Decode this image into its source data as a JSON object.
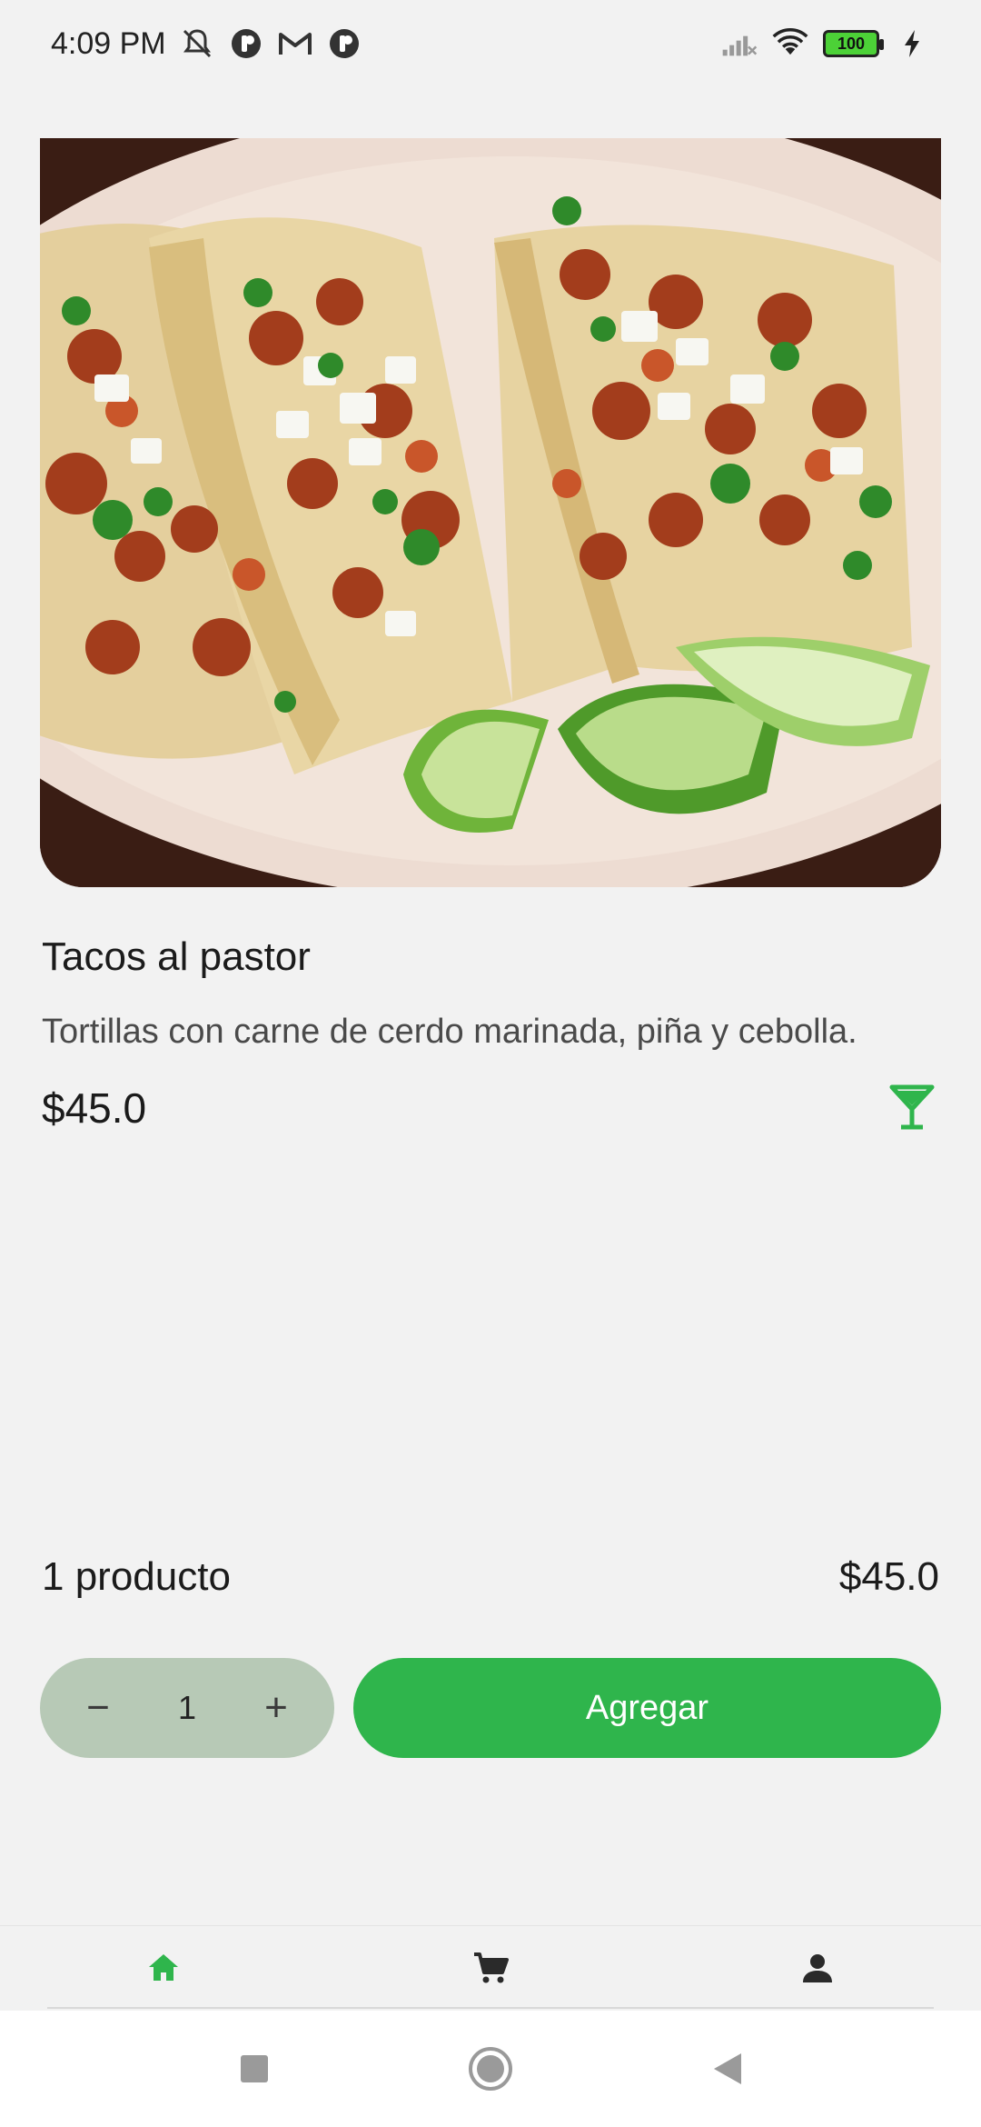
{
  "status_bar": {
    "time": "4:09 PM",
    "battery_level": "100",
    "icons": [
      "mute-icon",
      "app-notification-icon",
      "gmail-icon",
      "app-notification-icon",
      "signal-icon",
      "wifi-icon",
      "battery-icon",
      "charging-icon"
    ]
  },
  "product": {
    "name": "Tacos al pastor",
    "description": "Tortillas con carne de cerdo marinada, piña y cebolla.",
    "price": "$45.0",
    "category_icon": "cocktail-icon"
  },
  "summary": {
    "count": "1 producto",
    "total": "$45.0"
  },
  "stepper": {
    "minus": "−",
    "value": "1",
    "plus": "+"
  },
  "actions": {
    "add_label": "Agregar"
  },
  "bottom_nav": {
    "items": [
      "home-icon",
      "cart-icon",
      "profile-icon"
    ],
    "active": "home-icon"
  },
  "colors": {
    "accent": "#2fb54c",
    "stepper_bg": "#b7c9b6",
    "background": "#f2f2f2"
  }
}
